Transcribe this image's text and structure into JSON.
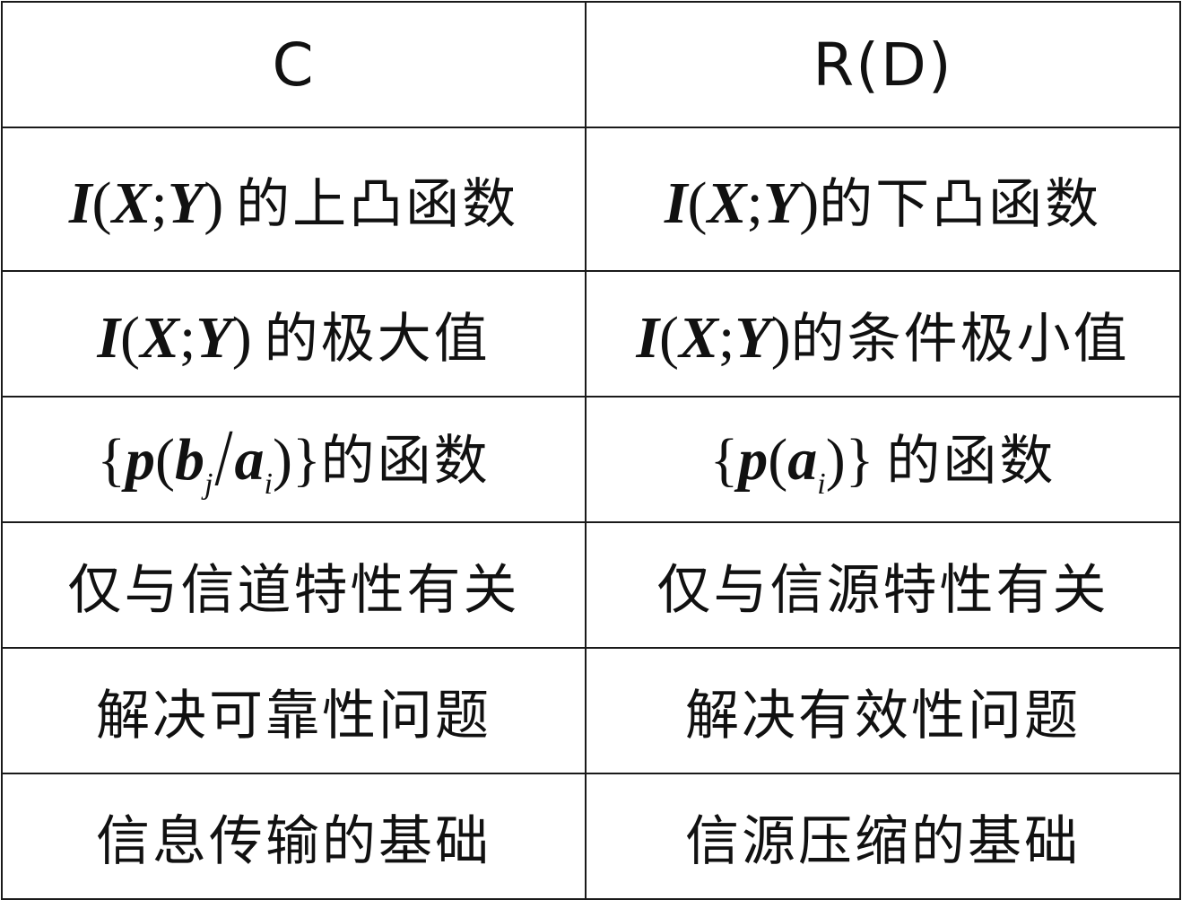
{
  "table": {
    "headers": {
      "c": "C",
      "rd": "R(D)"
    },
    "rows": [
      {
        "left": {
          "I": "I",
          "open": "(",
          "X": "X",
          "semi": ";",
          "Y": "Y",
          "close": ")",
          "text": "的上凸函数"
        },
        "right": {
          "I": "I",
          "open": "(",
          "X": "X",
          "semi": ";",
          "Y": "Y",
          "close": ")",
          "text": "的下凸函数"
        }
      },
      {
        "left": {
          "I": "I",
          "open": "(",
          "X": "X",
          "semi": ";",
          "Y": "Y",
          "close": ")",
          "text": "的极大值"
        },
        "right": {
          "I": "I",
          "open": "(",
          "X": "X",
          "semi": ";",
          "Y": "Y",
          "close": ")",
          "text": "的条件极小值"
        }
      },
      {
        "left": {
          "lbrace": "{",
          "p": "p",
          "open": "(",
          "b": "b",
          "j": "j",
          "slash": "/",
          "a": "a",
          "i": "i",
          "close": ")",
          "rbrace": "}",
          "text": "的函数"
        },
        "right": {
          "lbrace": "{",
          "p": "p",
          "open": "(",
          "a": "a",
          "i": "i",
          "close": ")",
          "rbrace": "}",
          "text": "的函数"
        }
      },
      {
        "left": "仅与信道特性有关",
        "right": "仅与信源特性有关"
      },
      {
        "left": "解决可靠性问题",
        "right": "解决有效性问题"
      },
      {
        "left": "信息传输的基础",
        "right": "信源压缩的基础"
      }
    ]
  }
}
